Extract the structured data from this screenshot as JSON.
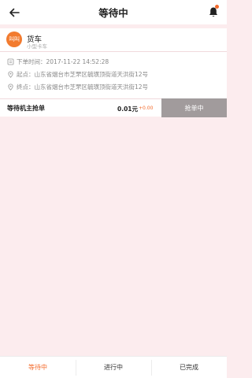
{
  "header": {
    "title": "等待中",
    "back_icon": "arrow-left-icon",
    "bell_icon": "bell-icon",
    "notification_dot_color": "#f36b2c"
  },
  "order": {
    "avatar_text": "叫叫",
    "avatar_color": "#f27b2f",
    "vehicle_type": "货车",
    "vehicle_sub": "小型卡车",
    "order_time": "下单时间：2017-11-22 14:52:28",
    "start_address": "起点：山东省烟台市芝罘区毓璜顶街道天洪街12号",
    "end_address": "终点：山东省烟台市芝罘区毓璜顶街道天洪街12号",
    "status_label": "等待机主抢单",
    "price": "0.01元",
    "price_diff": "+0.00",
    "grab_button_label": "抢单中",
    "grab_button_color": "#a19b9c"
  },
  "tabs": [
    {
      "label": "等待中",
      "active": true
    },
    {
      "label": "进行中",
      "active": false
    },
    {
      "label": "已完成",
      "active": false
    }
  ],
  "accent_color": "#f36b2c",
  "background_color": "#fcecee"
}
